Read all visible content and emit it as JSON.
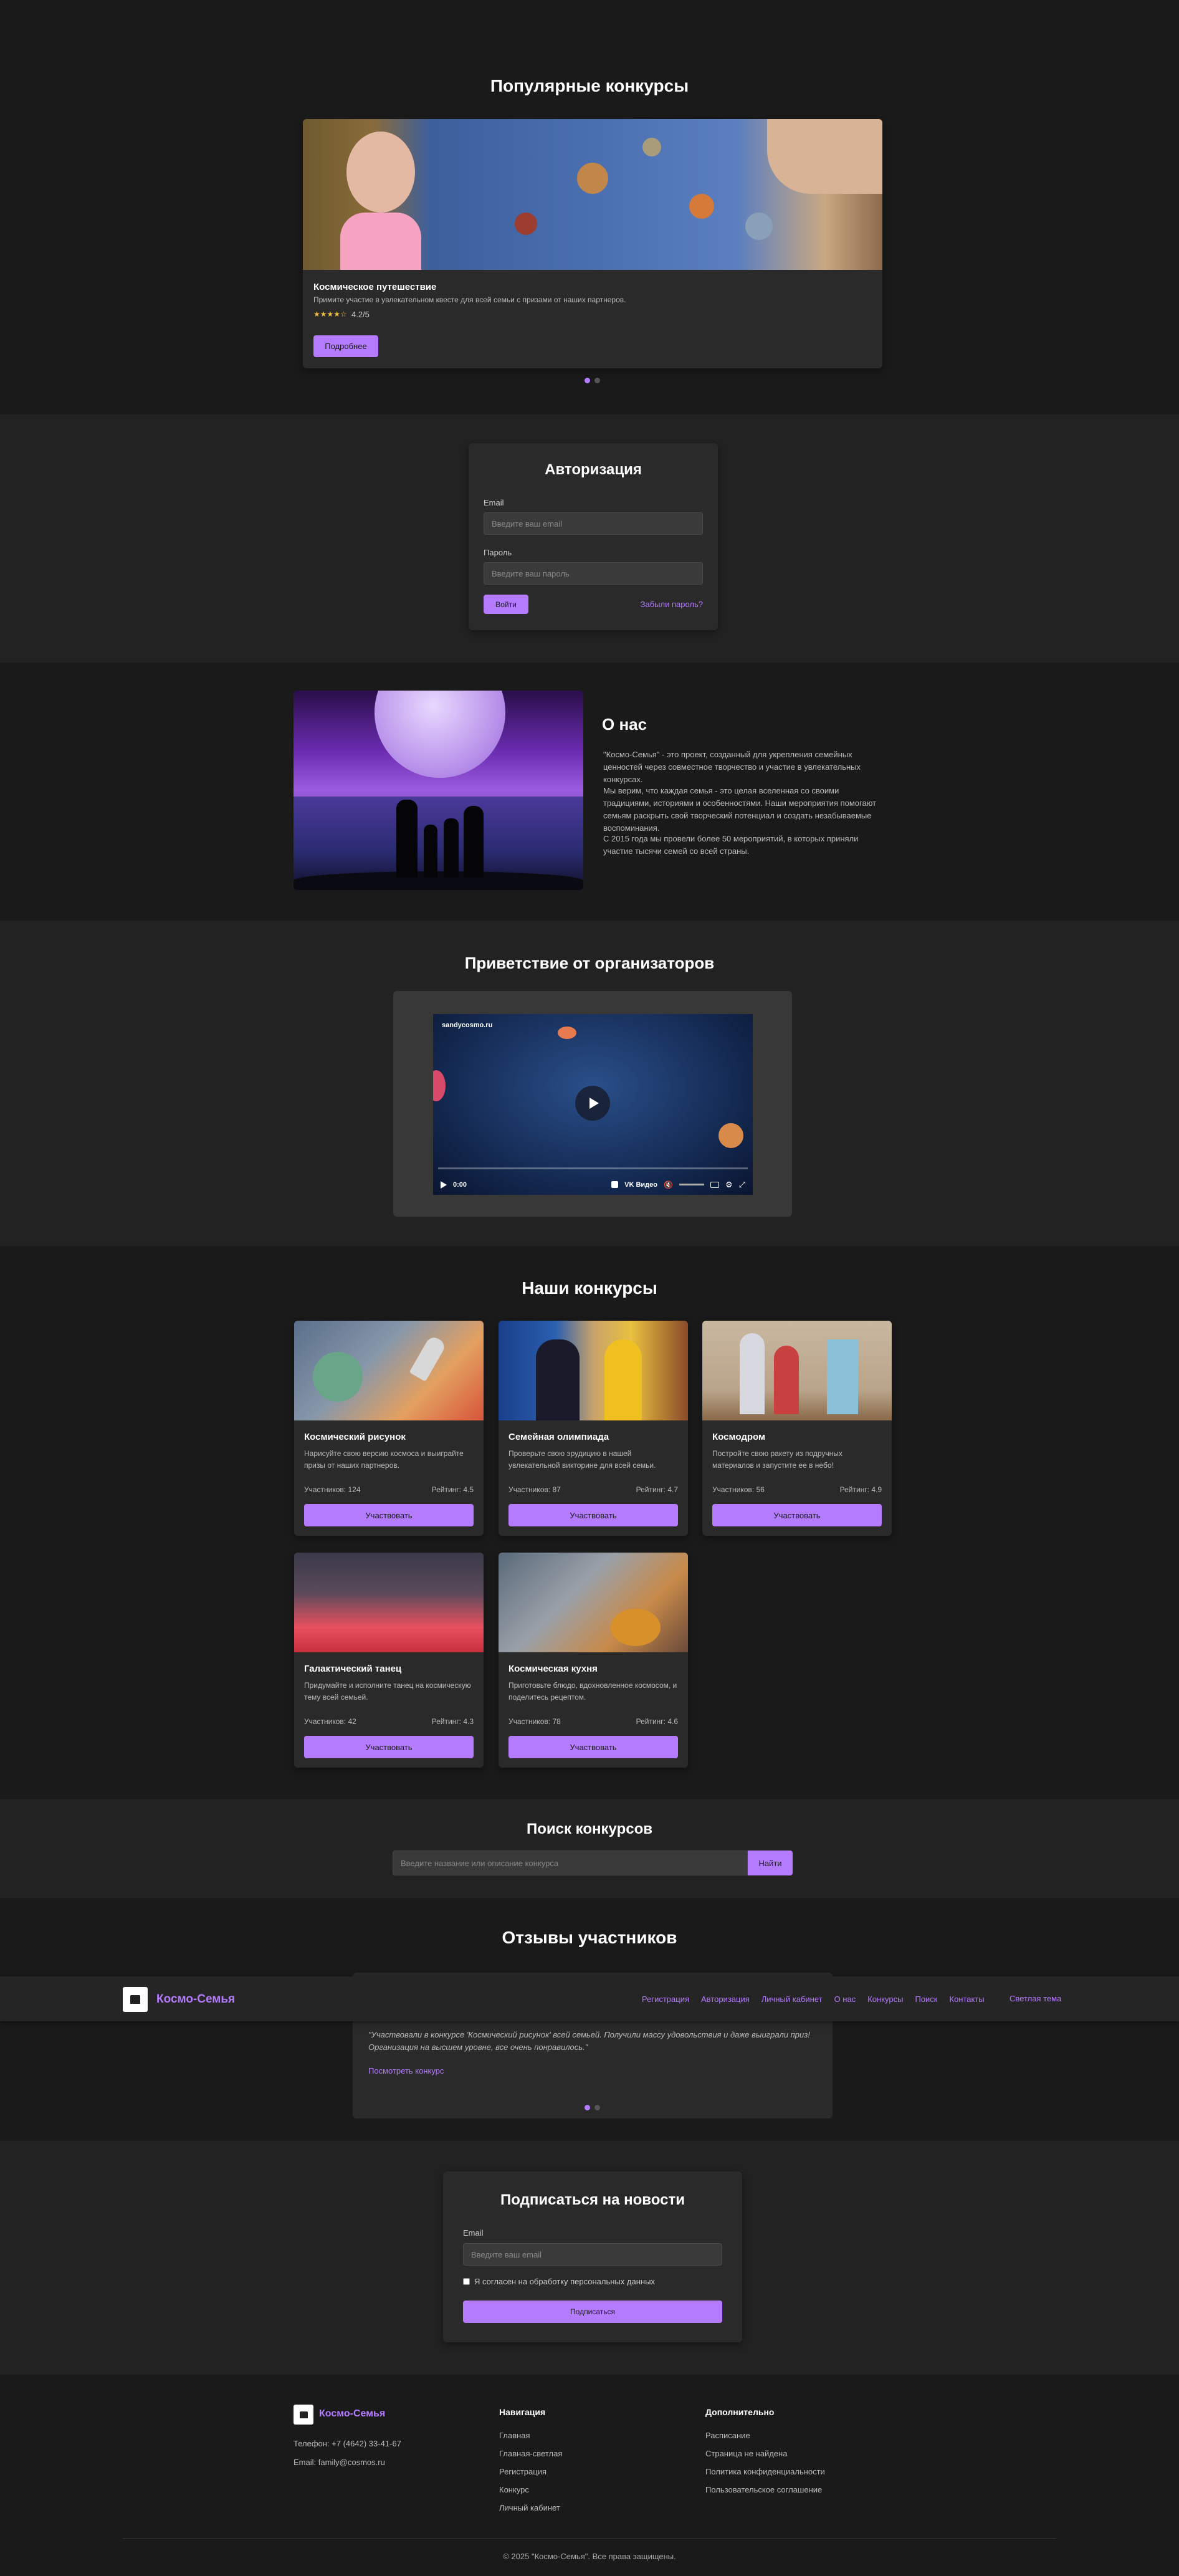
{
  "popular": {
    "title": "Популярные конкурсы",
    "card": {
      "title": "Космическое путешествие",
      "desc": "Примите участие в увлекательном квесте для всей семьи с призами от наших партнеров.",
      "stars": "★★★★☆",
      "rating": "4.2/5",
      "button": "Подробнее"
    }
  },
  "auth": {
    "title": "Авторизация",
    "email_label": "Email",
    "email_placeholder": "Введите ваш email",
    "password_label": "Пароль",
    "password_placeholder": "Введите ваш пароль",
    "login_button": "Войти",
    "forgot": "Забыли пароль?"
  },
  "about": {
    "title": "О нас",
    "p1": "\"Космо-Семья\" - это проект, созданный для укрепления семейных ценностей через совместное творчество и участие в увлекательных конкурсах.",
    "p2": "Мы верим, что каждая семья - это целая вселенная со своими традициями, историями и особенностями. Наши мероприятия помогают семьям раскрыть свой творческий потенциал и создать незабываемые воспоминания.",
    "p3": "С 2015 года мы провели более 50 мероприятий, в которых приняли участие тысячи семей со всей страны."
  },
  "greeting": {
    "title": "Приветствие от организаторов",
    "video": {
      "watermark": "sandycosmo.ru",
      "time": "0:00",
      "brand": "VK Видео"
    }
  },
  "contests": {
    "title": "Наши конкурсы",
    "participants_label": "Участников:",
    "rating_label": "Рейтинг:",
    "button": "Участвовать",
    "items": [
      {
        "title": "Космический рисунок",
        "desc": "Нарисуйте свою версию космоса и выиграйте призы от наших партнеров.",
        "participants": "Участников: 124",
        "rating": "Рейтинг: 4.5"
      },
      {
        "title": "Семейная олимпиада",
        "desc": "Проверьте свою эрудицию в нашей увлекательной викторине для всей семьи.",
        "participants": "Участников: 87",
        "rating": "Рейтинг: 4.7"
      },
      {
        "title": "Космодром",
        "desc": "Постройте свою ракету из подручных материалов и запустите ее в небо!",
        "participants": "Участников: 56",
        "rating": "Рейтинг: 4.9"
      },
      {
        "title": "Галактический танец",
        "desc": "Придумайте и исполните танец на космическую тему всей семьей.",
        "participants": "Участников: 42",
        "rating": "Рейтинг: 4.3"
      },
      {
        "title": "Космическая кухня",
        "desc": "Приготовьте блюдо, вдохновленное космосом, и поделитесь рецептом.",
        "participants": "Участников: 78",
        "rating": "Рейтинг: 4.6"
      }
    ]
  },
  "search": {
    "title": "Поиск конкурсов",
    "placeholder": "Введите название или описание конкурса",
    "button": "Найти"
  },
  "reviews": {
    "title": "Отзывы участников",
    "quote": "\"Участвовали в конкурсе 'Космический рисунок' всей семьей. Получили массу удовольствия и даже выиграли приз! Организация на высшем уровне, все очень понравилось.\"",
    "link": "Посмотреть конкурс"
  },
  "navbar": {
    "brand": "Космо-Семья",
    "items": [
      "Регистрация",
      "Авторизация",
      "Личный кабинет",
      "О нас",
      "Конкурсы",
      "Поиск",
      "Контакты"
    ],
    "theme": "Светлая тема"
  },
  "subscribe": {
    "title": "Подписаться на новости",
    "email_label": "Email",
    "email_placeholder": "Введите ваш email",
    "consent": "Я согласен на обработку персональных данных",
    "button": "Подписаться"
  },
  "footer": {
    "brand": "Космо-Семья",
    "phone": "Телефон: +7 (4642) 33-41-67",
    "email": "Email: family@cosmos.ru",
    "nav_title": "Навигация",
    "nav_items": [
      "Главная",
      "Главная-светлая",
      "Регистрация",
      "Конкурс",
      "Личный кабинет"
    ],
    "extra_title": "Дополнительно",
    "extra_items": [
      "Расписание",
      "Страница не найдена",
      "Политика конфиденциальности",
      "Пользовательское соглашение"
    ],
    "copyright": "© 2025 \"Космо-Семья\". Все права защищены."
  },
  "colors": {
    "accent": "#b57bff",
    "bg_dark": "#1a1a1a",
    "bg_section": "#222222",
    "card": "#2a2a2a"
  }
}
